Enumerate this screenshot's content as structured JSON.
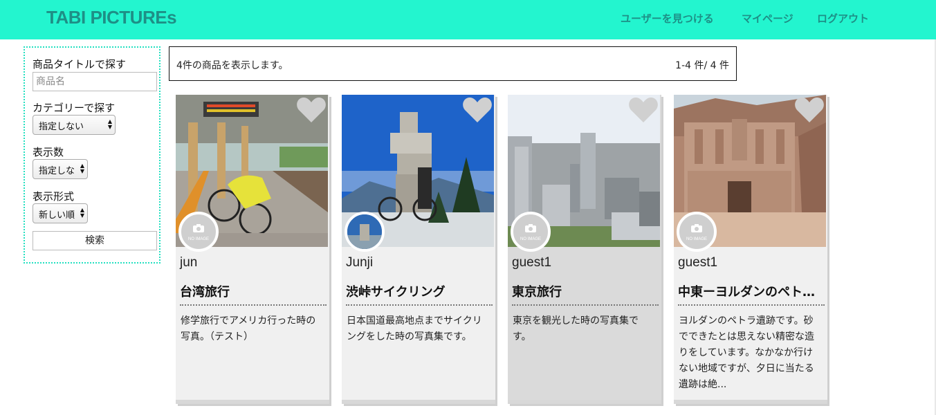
{
  "header": {
    "brand": "TABI PICTUREs",
    "nav": [
      "ユーザーを見つける",
      "マイページ",
      "ログアウト"
    ]
  },
  "sidebar": {
    "title_search_label": "商品タイトルで探す",
    "title_search_placeholder": "商品名",
    "category_label": "カテゴリーで探す",
    "category_value": "指定しない",
    "count_label": "表示数",
    "count_value": "指定しな",
    "format_label": "表示形式",
    "format_value": "新しい順",
    "search_button": "検索"
  },
  "results": {
    "message": "4件の商品を表示します。",
    "count": "1-4 件/ 4 件"
  },
  "avatar_placeholder": "NO IMAGE",
  "cards": [
    {
      "user": "jun",
      "title": "台湾旅行",
      "description": "修学旅行でアメリカ行った時の写真。（テスト）"
    },
    {
      "user": "Junji",
      "title": "渋峠サイクリング",
      "description": "日本国道最高地点までサイクリングをした時の写真集です。"
    },
    {
      "user": "guest1",
      "title": "東京旅行",
      "description": "東京を観光した時の写真集です。"
    },
    {
      "user": "guest1",
      "title": "中東ーヨルダンのペトラ遺跡",
      "description": "ヨルダンのペトラ遺跡です。砂でできたとは思えない精密な造りをしています。なかなか行けない地域ですが、夕日に当たる遺跡は絶..."
    }
  ],
  "colors": {
    "header_bg": "#23f5cf",
    "brand_text": "#1e8f86",
    "heart": "#d0d0d0"
  }
}
